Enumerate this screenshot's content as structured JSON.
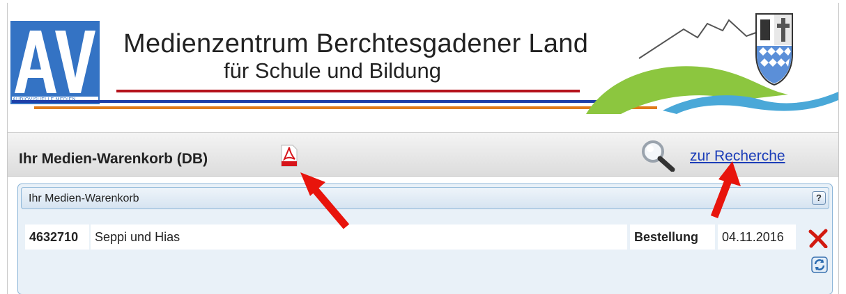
{
  "banner": {
    "logo_text": "AV",
    "logo_subtext": "AUDIOVISUELLE MEDIEN",
    "title": "Medienzentrum Berchtesgadener Land",
    "subtitle": "für Schule und Bildung"
  },
  "toolbar": {
    "title": "Ihr Medien-Warenkorb (DB)",
    "pdf_icon": "pdf-icon",
    "search_icon": "magnifier-icon",
    "recherche_label": "zur Recherche"
  },
  "panel": {
    "title": "Ihr Medien-Warenkorb",
    "help_label": "?",
    "items": [
      {
        "number": "4632710",
        "title": "Seppi und Hias",
        "type": "Bestellung",
        "date": "04.11.2016"
      }
    ]
  },
  "colors": {
    "logo_blue": "#3473c4",
    "line_red": "#b5121b",
    "line_blue": "#1e3fa8",
    "line_orange": "#e07b1a",
    "link": "#1b3db8",
    "panel_border": "#8db6d8",
    "annotation_arrow": "#e8140c"
  }
}
